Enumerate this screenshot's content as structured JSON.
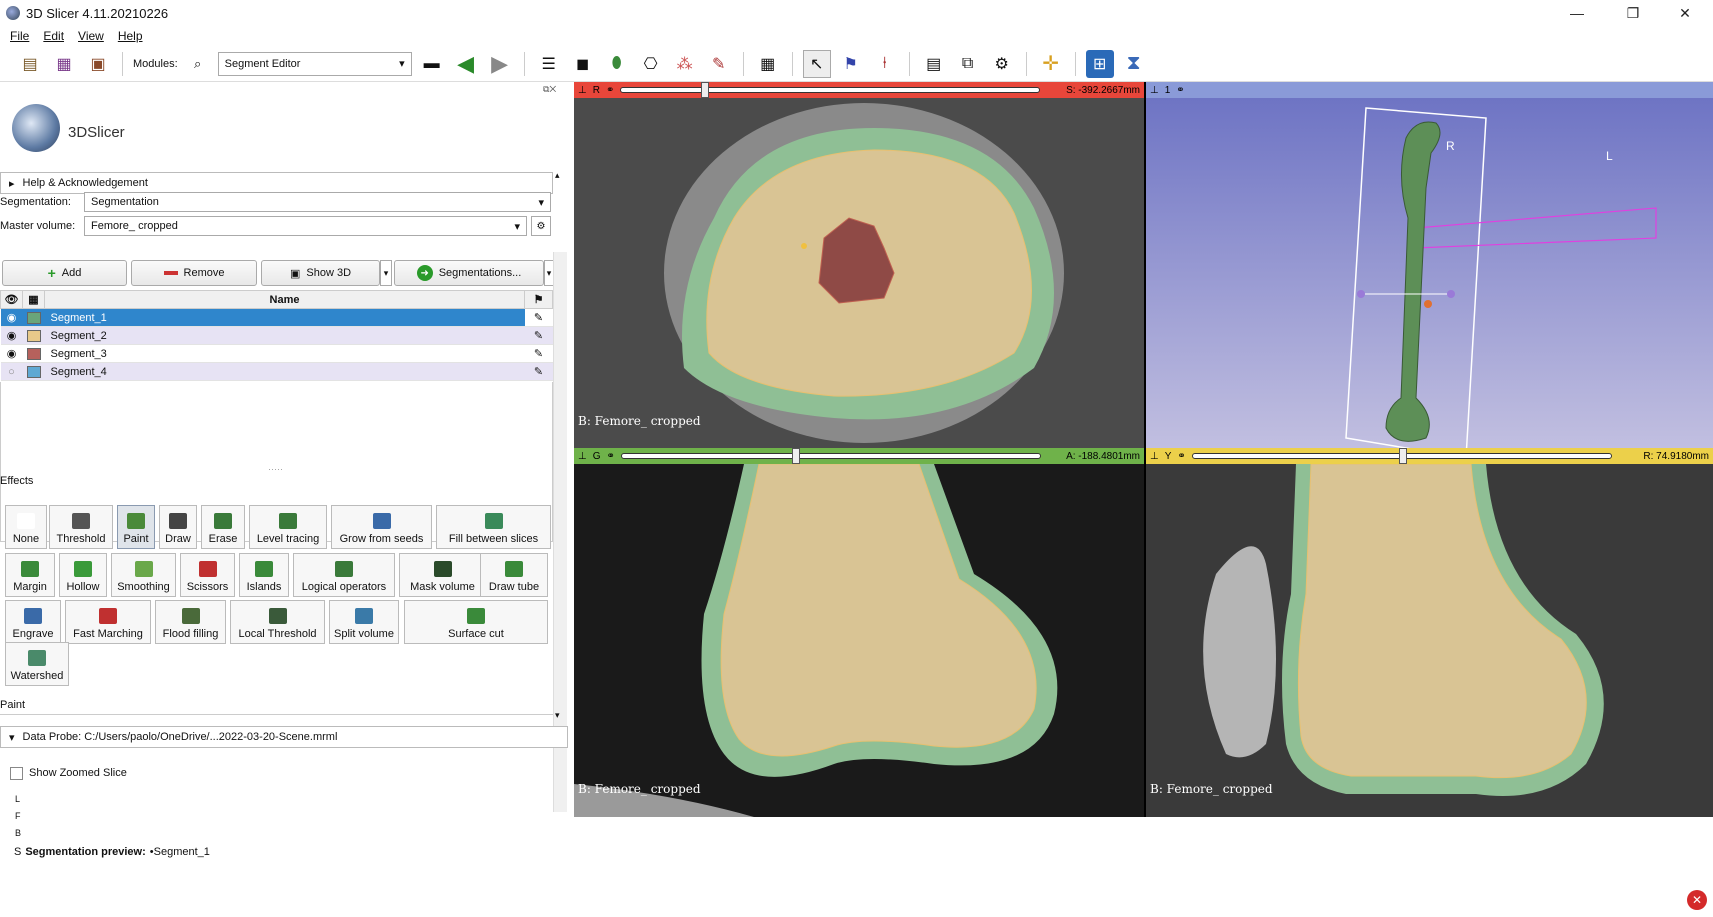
{
  "window": {
    "title": "3D Slicer 4.11.20210226",
    "minimize": "—",
    "maximize": "❐",
    "close": "✕"
  },
  "menu": [
    "File",
    "Edit",
    "View",
    "Help"
  ],
  "toolbar": {
    "modules_label": "Modules:",
    "module_selected": "Segment Editor"
  },
  "logo_text": "3DSlicer",
  "help_section": "Help & Acknowledgement",
  "segmentation": {
    "label": "Segmentation:",
    "value": "Segmentation"
  },
  "master_volume": {
    "label": "Master volume:",
    "value": "Femore_ cropped"
  },
  "buttons": {
    "add": "Add",
    "remove": "Remove",
    "show3d": "Show 3D",
    "segmentations": "Segmentations..."
  },
  "table": {
    "header_name": "Name",
    "rows": [
      {
        "name": "Segment_1",
        "color": "#6aa57a",
        "visible": "eye-open",
        "selected": true
      },
      {
        "name": "Segment_2",
        "color": "#e8c98a",
        "visible": "eye-open",
        "selected": false
      },
      {
        "name": "Segment_3",
        "color": "#b6615c",
        "visible": "eye-open",
        "selected": false
      },
      {
        "name": "Segment_4",
        "color": "#5fa8d3",
        "visible": "eye-closed",
        "selected": false
      }
    ]
  },
  "effects_label": "Effects",
  "effects": [
    {
      "label": "None",
      "color": "#ffffff"
    },
    {
      "label": "Threshold",
      "color": "#555555"
    },
    {
      "label": "Paint",
      "color": "#4a8a3a"
    },
    {
      "label": "Draw",
      "color": "#444444"
    },
    {
      "label": "Erase",
      "color": "#3a7a3a"
    },
    {
      "label": "Level tracing",
      "color": "#3a7a3a"
    },
    {
      "label": "Grow from seeds",
      "color": "#3a6aa8"
    },
    {
      "label": "Fill between slices",
      "color": "#3a8a5a"
    },
    {
      "label": "Margin",
      "color": "#3a8a3a"
    },
    {
      "label": "Hollow",
      "color": "#3a9a3a"
    },
    {
      "label": "Smoothing",
      "color": "#6aa84a"
    },
    {
      "label": "Scissors",
      "color": "#c03030"
    },
    {
      "label": "Islands",
      "color": "#3a8a3a"
    },
    {
      "label": "Logical operators",
      "color": "#3a7a3a"
    },
    {
      "label": "Mask volume",
      "color": "#2a4a2a"
    },
    {
      "label": "Draw tube",
      "color": "#3a8a3a"
    },
    {
      "label": "Engrave",
      "color": "#3a6aa8"
    },
    {
      "label": "Fast Marching",
      "color": "#c03030"
    },
    {
      "label": "Flood filling",
      "color": "#4a6a3a"
    },
    {
      "label": "Local Threshold",
      "color": "#3a5a3a"
    },
    {
      "label": "Split volume",
      "color": "#3a7aa8"
    },
    {
      "label": "Surface cut",
      "color": "#3a8a3a"
    },
    {
      "label": "Watershed",
      "color": "#4a8a6a"
    }
  ],
  "paint_label": "Paint",
  "data_probe": "Data Probe: C:/Users/paolo/OneDrive/...2022-03-20-Scene.mrml",
  "show_zoomed": "Show Zoomed Slice",
  "probe_lines": [
    "L",
    "F",
    "B"
  ],
  "preview": {
    "prefix": "S",
    "label": "Segmentation preview:",
    "value": "•Segment_1"
  },
  "views": {
    "red": {
      "letter": "R",
      "readout": "S: -392.2667mm",
      "name": "B: Femore_ cropped",
      "color": "#e8463a",
      "slider": 0.22
    },
    "green": {
      "letter": "G",
      "readout": "A: -188.4801mm",
      "name": "B: Femore_ cropped",
      "color": "#6fb24a",
      "slider": 0.4
    },
    "yellow": {
      "letter": "Y",
      "readout": "R: 74.9180mm",
      "name": "B: Femore_ cropped",
      "color": "#ecd04a",
      "slider": 0.5
    },
    "threed": {
      "number": "1",
      "orient": [
        "R",
        "L"
      ],
      "color": "#8a9ad8"
    }
  }
}
